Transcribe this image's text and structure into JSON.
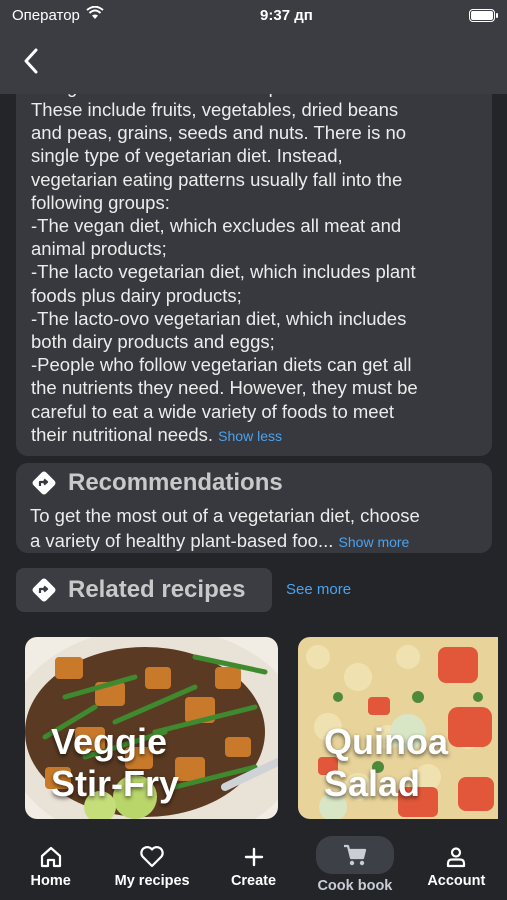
{
  "status_bar": {
    "carrier": "Оператор",
    "time": "9:37 дп"
  },
  "description": {
    "text": "A vegetarian diet focuses on plants for food.\nThese include fruits, vegetables, dried beans\nand peas, grains, seeds and nuts. There is no\nsingle type of vegetarian diet. Instead,\nvegetarian eating patterns usually fall into the\nfollowing groups:\n-The vegan diet, which excludes all meat and\nanimal products;\n-The lacto vegetarian diet, which includes plant\nfoods plus dairy products;\n-The lacto-ovo vegetarian diet, which includes\nboth dairy products and eggs;\n-People who follow vegetarian diets can get all\nthe nutrients they need. However, they must be\ncareful to eat a wide variety of foods to meet\ntheir nutritional needs.",
    "toggle_label": "Show less"
  },
  "recommendations": {
    "title": "Recommendations",
    "line1": "To get the most out of a vegetarian diet, choose",
    "line2": "a variety of healthy plant-based foo...",
    "toggle_label": "Show more"
  },
  "related": {
    "title": "Related recipes",
    "see_more_label": "See more",
    "recipes": [
      {
        "title": "Veggie\nStir-Fry"
      },
      {
        "title": "Quinoa\nSalad"
      }
    ]
  },
  "tabs": [
    {
      "label": "Home",
      "icon": "home-icon"
    },
    {
      "label": "My recipes",
      "icon": "heart-icon"
    },
    {
      "label": "Create",
      "icon": "plus-icon"
    },
    {
      "label": "Cook book",
      "icon": "cart-icon",
      "active": true
    },
    {
      "label": "Account",
      "icon": "person-icon"
    }
  ],
  "colors": {
    "background": "#232529",
    "card": "#37393e",
    "link": "#4aa3f0",
    "header": "#3b3d42"
  }
}
